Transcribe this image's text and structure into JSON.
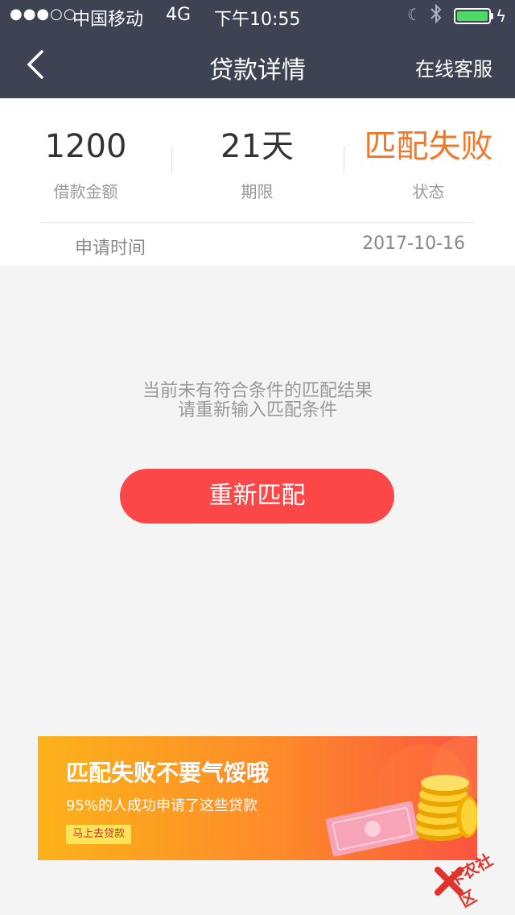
{
  "status_bar": {
    "signal": "●●●○○",
    "carrier": "中国移动",
    "network": "4G",
    "time": "下午10:55"
  },
  "nav": {
    "title": "贷款详情",
    "right_label": "在线客服"
  },
  "summary": {
    "amount_value": "1200",
    "amount_label": "借款金额",
    "term_value": "21天",
    "term_label": "期限",
    "status_value": "匹配失败",
    "status_label": "状态",
    "apply_time_label": "申请时间",
    "apply_time_value": "2017-10-16"
  },
  "empty_message": {
    "line1": "当前未有符合条件的匹配结果",
    "line2": "请重新输入匹配条件"
  },
  "rematch_button": "重新匹配",
  "banner": {
    "title": "匹配失败不要气馁哦",
    "subtitle": "95%的人成功申请了这些贷款",
    "button": "马上去贷款"
  },
  "watermark": "卡农社区",
  "colors": {
    "nav_bg": "#3d4352",
    "status_fail": "#f0782a",
    "button": "#fb4748",
    "battery": "#4cd964"
  }
}
